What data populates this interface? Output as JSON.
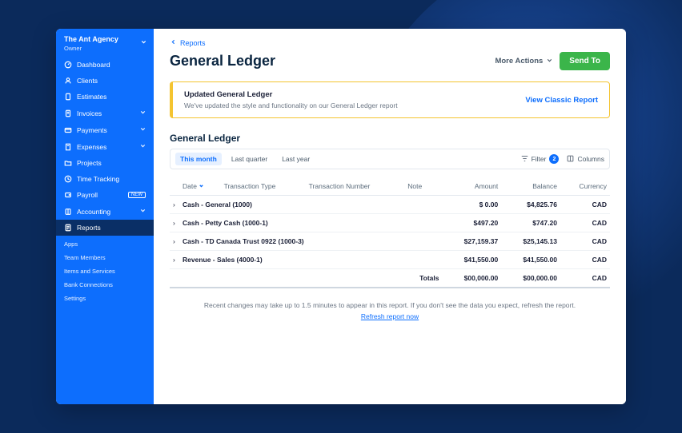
{
  "org": {
    "name": "The Ant Agency",
    "role": "Owner"
  },
  "nav": {
    "primary": [
      {
        "label": "Dashboard",
        "icon": "speedometer"
      },
      {
        "label": "Clients",
        "icon": "person"
      },
      {
        "label": "Estimates",
        "icon": "document"
      },
      {
        "label": "Invoices",
        "icon": "invoice",
        "expandable": true
      },
      {
        "label": "Payments",
        "icon": "card",
        "expandable": true
      },
      {
        "label": "Expenses",
        "icon": "receipt",
        "expandable": true
      },
      {
        "label": "Projects",
        "icon": "folder"
      },
      {
        "label": "Time Tracking",
        "icon": "clock"
      },
      {
        "label": "Payroll",
        "icon": "wallet",
        "badge": "NEW"
      },
      {
        "label": "Accounting",
        "icon": "book",
        "expandable": true
      },
      {
        "label": "Reports",
        "icon": "report",
        "active": true
      }
    ],
    "secondary": [
      {
        "label": "Apps"
      },
      {
        "label": "Team Members"
      },
      {
        "label": "Items and Services"
      },
      {
        "label": "Bank Connections"
      },
      {
        "label": "Settings"
      }
    ]
  },
  "breadcrumb": {
    "back_label": "Reports"
  },
  "page": {
    "title": "General Ledger",
    "more_actions_label": "More Actions",
    "send_to_label": "Send To"
  },
  "notice": {
    "title": "Updated General Ledger",
    "body": "We've updated the style and functionality on our General Ledger report",
    "link": "View Classic Report"
  },
  "report": {
    "title": "General Ledger",
    "tabs": [
      {
        "label": "This month",
        "active": true
      },
      {
        "label": "Last quarter"
      },
      {
        "label": "Last year"
      }
    ],
    "tools": {
      "filter_label": "Filter",
      "filter_count": "2",
      "columns_label": "Columns"
    },
    "columns": {
      "date": "Date",
      "txn_type": "Transaction Type",
      "txn_number": "Transaction Number",
      "note": "Note",
      "amount": "Amount",
      "balance": "Balance",
      "currency": "Currency"
    },
    "rows": [
      {
        "name": "Cash - General (1000)",
        "amount": "$ 0.00",
        "balance": "$4,825.76",
        "currency": "CAD"
      },
      {
        "name": "Cash - Petty Cash (1000-1)",
        "amount": "$497.20",
        "balance": "$747.20",
        "currency": "CAD"
      },
      {
        "name": "Cash - TD Canada Trust 0922 (1000-3)",
        "amount": "$27,159.37",
        "balance": "$25,145.13",
        "currency": "CAD"
      },
      {
        "name": "Revenue - Sales (4000-1)",
        "amount": "$41,550.00",
        "balance": "$41,550.00",
        "currency": "CAD"
      }
    ],
    "totals": {
      "label": "Totals",
      "amount": "$00,000.00",
      "balance": "$00,000.00",
      "currency": "CAD"
    }
  },
  "footer": {
    "note": "Recent changes may take up to 1.5 minutes to appear in this report.  If you don't see the data you expect, refresh the report.",
    "refresh_label": "Refresh report now"
  }
}
